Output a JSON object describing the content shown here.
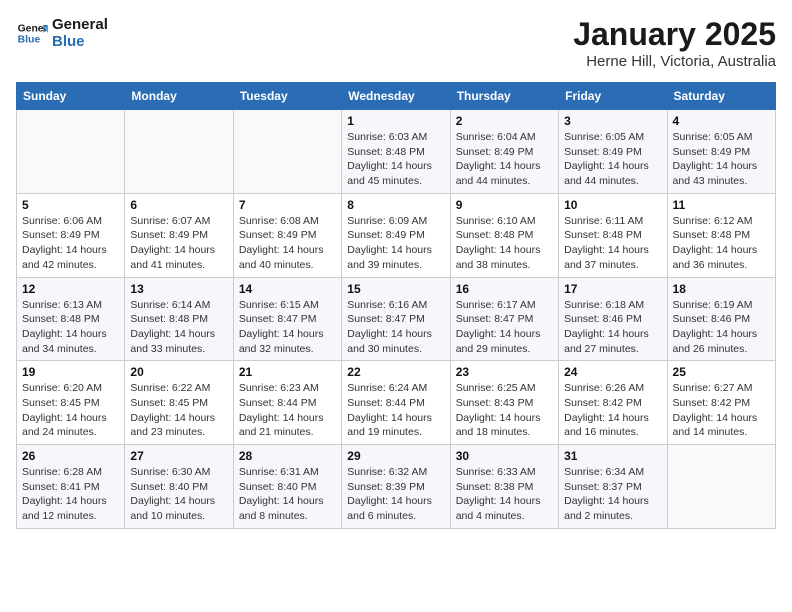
{
  "logo": {
    "line1": "General",
    "line2": "Blue"
  },
  "title": "January 2025",
  "location": "Herne Hill, Victoria, Australia",
  "days_of_week": [
    "Sunday",
    "Monday",
    "Tuesday",
    "Wednesday",
    "Thursday",
    "Friday",
    "Saturday"
  ],
  "weeks": [
    [
      {
        "day": "",
        "info": ""
      },
      {
        "day": "",
        "info": ""
      },
      {
        "day": "",
        "info": ""
      },
      {
        "day": "1",
        "info": "Sunrise: 6:03 AM\nSunset: 8:48 PM\nDaylight: 14 hours\nand 45 minutes."
      },
      {
        "day": "2",
        "info": "Sunrise: 6:04 AM\nSunset: 8:49 PM\nDaylight: 14 hours\nand 44 minutes."
      },
      {
        "day": "3",
        "info": "Sunrise: 6:05 AM\nSunset: 8:49 PM\nDaylight: 14 hours\nand 44 minutes."
      },
      {
        "day": "4",
        "info": "Sunrise: 6:05 AM\nSunset: 8:49 PM\nDaylight: 14 hours\nand 43 minutes."
      }
    ],
    [
      {
        "day": "5",
        "info": "Sunrise: 6:06 AM\nSunset: 8:49 PM\nDaylight: 14 hours\nand 42 minutes."
      },
      {
        "day": "6",
        "info": "Sunrise: 6:07 AM\nSunset: 8:49 PM\nDaylight: 14 hours\nand 41 minutes."
      },
      {
        "day": "7",
        "info": "Sunrise: 6:08 AM\nSunset: 8:49 PM\nDaylight: 14 hours\nand 40 minutes."
      },
      {
        "day": "8",
        "info": "Sunrise: 6:09 AM\nSunset: 8:49 PM\nDaylight: 14 hours\nand 39 minutes."
      },
      {
        "day": "9",
        "info": "Sunrise: 6:10 AM\nSunset: 8:48 PM\nDaylight: 14 hours\nand 38 minutes."
      },
      {
        "day": "10",
        "info": "Sunrise: 6:11 AM\nSunset: 8:48 PM\nDaylight: 14 hours\nand 37 minutes."
      },
      {
        "day": "11",
        "info": "Sunrise: 6:12 AM\nSunset: 8:48 PM\nDaylight: 14 hours\nand 36 minutes."
      }
    ],
    [
      {
        "day": "12",
        "info": "Sunrise: 6:13 AM\nSunset: 8:48 PM\nDaylight: 14 hours\nand 34 minutes."
      },
      {
        "day": "13",
        "info": "Sunrise: 6:14 AM\nSunset: 8:48 PM\nDaylight: 14 hours\nand 33 minutes."
      },
      {
        "day": "14",
        "info": "Sunrise: 6:15 AM\nSunset: 8:47 PM\nDaylight: 14 hours\nand 32 minutes."
      },
      {
        "day": "15",
        "info": "Sunrise: 6:16 AM\nSunset: 8:47 PM\nDaylight: 14 hours\nand 30 minutes."
      },
      {
        "day": "16",
        "info": "Sunrise: 6:17 AM\nSunset: 8:47 PM\nDaylight: 14 hours\nand 29 minutes."
      },
      {
        "day": "17",
        "info": "Sunrise: 6:18 AM\nSunset: 8:46 PM\nDaylight: 14 hours\nand 27 minutes."
      },
      {
        "day": "18",
        "info": "Sunrise: 6:19 AM\nSunset: 8:46 PM\nDaylight: 14 hours\nand 26 minutes."
      }
    ],
    [
      {
        "day": "19",
        "info": "Sunrise: 6:20 AM\nSunset: 8:45 PM\nDaylight: 14 hours\nand 24 minutes."
      },
      {
        "day": "20",
        "info": "Sunrise: 6:22 AM\nSunset: 8:45 PM\nDaylight: 14 hours\nand 23 minutes."
      },
      {
        "day": "21",
        "info": "Sunrise: 6:23 AM\nSunset: 8:44 PM\nDaylight: 14 hours\nand 21 minutes."
      },
      {
        "day": "22",
        "info": "Sunrise: 6:24 AM\nSunset: 8:44 PM\nDaylight: 14 hours\nand 19 minutes."
      },
      {
        "day": "23",
        "info": "Sunrise: 6:25 AM\nSunset: 8:43 PM\nDaylight: 14 hours\nand 18 minutes."
      },
      {
        "day": "24",
        "info": "Sunrise: 6:26 AM\nSunset: 8:42 PM\nDaylight: 14 hours\nand 16 minutes."
      },
      {
        "day": "25",
        "info": "Sunrise: 6:27 AM\nSunset: 8:42 PM\nDaylight: 14 hours\nand 14 minutes."
      }
    ],
    [
      {
        "day": "26",
        "info": "Sunrise: 6:28 AM\nSunset: 8:41 PM\nDaylight: 14 hours\nand 12 minutes."
      },
      {
        "day": "27",
        "info": "Sunrise: 6:30 AM\nSunset: 8:40 PM\nDaylight: 14 hours\nand 10 minutes."
      },
      {
        "day": "28",
        "info": "Sunrise: 6:31 AM\nSunset: 8:40 PM\nDaylight: 14 hours\nand 8 minutes."
      },
      {
        "day": "29",
        "info": "Sunrise: 6:32 AM\nSunset: 8:39 PM\nDaylight: 14 hours\nand 6 minutes."
      },
      {
        "day": "30",
        "info": "Sunrise: 6:33 AM\nSunset: 8:38 PM\nDaylight: 14 hours\nand 4 minutes."
      },
      {
        "day": "31",
        "info": "Sunrise: 6:34 AM\nSunset: 8:37 PM\nDaylight: 14 hours\nand 2 minutes."
      },
      {
        "day": "",
        "info": ""
      }
    ]
  ]
}
